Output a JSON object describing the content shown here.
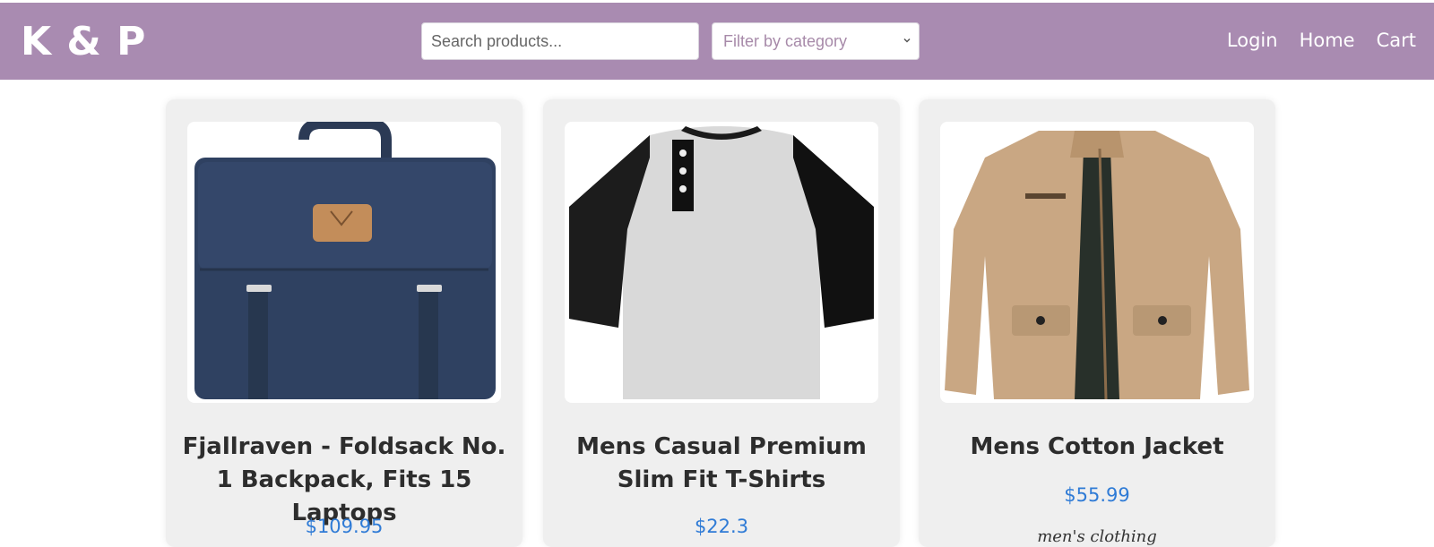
{
  "brand": {
    "logo_text": "K & P"
  },
  "search": {
    "placeholder": "Search products..."
  },
  "filter": {
    "selected": "Filter by category"
  },
  "nav": {
    "login": "Login",
    "home": "Home",
    "cart": "Cart"
  },
  "products": [
    {
      "title": "Fjallraven - Foldsack No. 1 Backpack, Fits 15 Laptops",
      "price": "$109.95"
    },
    {
      "title": "Mens Casual Premium Slim Fit T-Shirts",
      "price": "$22.3"
    },
    {
      "title": "Mens Cotton Jacket",
      "price": "$55.99",
      "category": "men's clothing"
    }
  ],
  "colors": {
    "navbar": "#a98bb1",
    "price": "#2f7bd6",
    "card": "#efefef"
  }
}
